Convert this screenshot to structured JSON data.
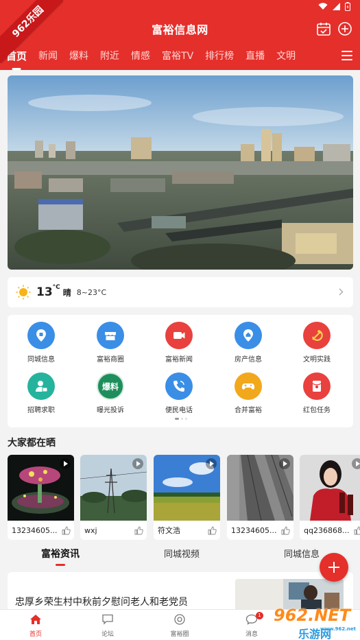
{
  "header": {
    "ribbon_text": "962乐园",
    "title": "富裕信息网",
    "calendar_icon": "calendar-check-icon",
    "add_icon": "plus-circle-icon"
  },
  "tabs": [
    {
      "label": "首页",
      "active": true
    },
    {
      "label": "新闻"
    },
    {
      "label": "爆料"
    },
    {
      "label": "附近"
    },
    {
      "label": "情感"
    },
    {
      "label": "富裕TV"
    },
    {
      "label": "排行榜"
    },
    {
      "label": "直播"
    },
    {
      "label": "文明"
    }
  ],
  "weather": {
    "temp": "13",
    "unit": "°C",
    "condition": "晴",
    "range": "8~23°C"
  },
  "services": [
    {
      "label": "同城信息",
      "color": "#3a8ee6",
      "icon": "location-icon"
    },
    {
      "label": "富裕商圈",
      "color": "#3a8ee6",
      "icon": "store-icon"
    },
    {
      "label": "富裕新闻",
      "color": "#e9413d",
      "icon": "video-camera-icon"
    },
    {
      "label": "房产信息",
      "color": "#3a8ee6",
      "icon": "house-icon"
    },
    {
      "label": "文明实践",
      "color": "#e9413d",
      "icon": "hammer-sickle-icon"
    },
    {
      "label": "招聘求职",
      "color": "#25b39e",
      "icon": "person-icon"
    },
    {
      "label": "曝光投诉",
      "color": "#1d8e5c",
      "icon": "exposure-badge-icon",
      "badge_text": "爆料"
    },
    {
      "label": "便民电话",
      "color": "#3a8ee6",
      "icon": "phone-icon"
    },
    {
      "label": "合并富裕",
      "color": "#f2a81c",
      "icon": "gamepad-icon"
    },
    {
      "label": "红包任务",
      "color": "#e9413d",
      "icon": "red-packet-icon"
    }
  ],
  "section_title": "大家都在晒",
  "videos": [
    {
      "name": "13234605..."
    },
    {
      "name": "wxj"
    },
    {
      "name": "符文浩"
    },
    {
      "name": "13234605..."
    },
    {
      "name": "qq236868..."
    }
  ],
  "subtabs": [
    {
      "label": "富裕资讯",
      "active": true
    },
    {
      "label": "同城视频"
    },
    {
      "label": "同城信息"
    }
  ],
  "news": {
    "title": "忠厚乡荣生村中秋前夕慰问老人和老党员"
  },
  "bottom_nav": [
    {
      "label": "首页",
      "icon": "home-icon",
      "active": true
    },
    {
      "label": "论坛",
      "icon": "chat-icon"
    },
    {
      "label": "富裕圈",
      "icon": "circle-icon"
    },
    {
      "label": "消息",
      "icon": "message-icon",
      "badge": "1"
    }
  ],
  "watermark": {
    "number": "962.NET",
    "sub": "乐游网",
    "site": "www.962.net"
  },
  "colors": {
    "brand_red": "#e42f2b"
  }
}
